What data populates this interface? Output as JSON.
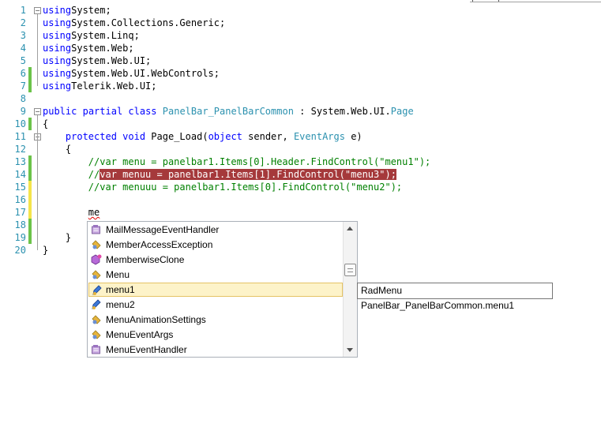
{
  "code_lines": [
    {
      "n": "1",
      "gutter": "none",
      "fold": "minus",
      "tokens": [
        [
          "kw",
          "using"
        ],
        [
          "",
          "System;"
        ]
      ]
    },
    {
      "n": "2",
      "gutter": "none",
      "fold": "",
      "tokens": [
        [
          "kw",
          "using"
        ],
        [
          "",
          "System.Collections.Generic;"
        ]
      ]
    },
    {
      "n": "3",
      "gutter": "none",
      "fold": "",
      "tokens": [
        [
          "kw",
          "using"
        ],
        [
          "",
          "System.Linq;"
        ]
      ]
    },
    {
      "n": "4",
      "gutter": "none",
      "fold": "",
      "tokens": [
        [
          "kw",
          "using"
        ],
        [
          "",
          "System.Web;"
        ]
      ]
    },
    {
      "n": "5",
      "gutter": "none",
      "fold": "",
      "tokens": [
        [
          "kw",
          "using"
        ],
        [
          "",
          "System.Web.UI;"
        ]
      ]
    },
    {
      "n": "6",
      "gutter": "saved",
      "fold": "",
      "tokens": [
        [
          "kw",
          "using"
        ],
        [
          "",
          "System.Web.UI.WebControls;"
        ]
      ]
    },
    {
      "n": "7",
      "gutter": "saved",
      "fold": "",
      "tokens": [
        [
          "kw",
          "using"
        ],
        [
          "",
          "Telerik.Web.UI;"
        ]
      ]
    },
    {
      "n": "8",
      "gutter": "none",
      "fold": "",
      "tokens": []
    },
    {
      "n": "9",
      "gutter": "none",
      "fold": "minus",
      "tokens": [
        [
          "kw",
          "public"
        ],
        [
          "",
          " "
        ],
        [
          "kw",
          "partial"
        ],
        [
          "",
          " "
        ],
        [
          "kw",
          "class"
        ],
        [
          "",
          " "
        ],
        [
          "ty",
          "PanelBar_PanelBarCommon"
        ],
        [
          "",
          " : System.Web.UI."
        ],
        [
          "ty",
          "Page"
        ]
      ]
    },
    {
      "n": "10",
      "gutter": "saved",
      "fold": "",
      "tokens": [
        [
          "",
          "{"
        ]
      ]
    },
    {
      "n": "11",
      "gutter": "none",
      "fold": "minus",
      "tokens": [
        [
          "",
          "    "
        ],
        [
          "kw",
          "protected"
        ],
        [
          "",
          " "
        ],
        [
          "kw",
          "void"
        ],
        [
          "",
          " Page_Load("
        ],
        [
          "kw",
          "object"
        ],
        [
          "",
          " sender, "
        ],
        [
          "ty",
          "EventArgs"
        ],
        [
          "",
          " e)"
        ]
      ]
    },
    {
      "n": "12",
      "gutter": "none",
      "fold": "",
      "tokens": [
        [
          "",
          "    {"
        ]
      ]
    },
    {
      "n": "13",
      "gutter": "saved",
      "fold": "",
      "tokens": [
        [
          "",
          "        "
        ],
        [
          "cm",
          "//var menu = panelbar1.Items[0].Header.FindControl(\"menu1\");"
        ]
      ]
    },
    {
      "n": "14",
      "gutter": "saved",
      "fold": "",
      "tokens": [
        [
          "",
          "        "
        ],
        [
          "cm",
          "//"
        ],
        [
          "hl",
          "var menuu = panelbar1.Items[1].FindControl(\"menu3\");"
        ]
      ]
    },
    {
      "n": "15",
      "gutter": "unsaved",
      "fold": "",
      "tokens": [
        [
          "",
          "        "
        ],
        [
          "cm",
          "//var menuuu = panelbar1.Items[0].FindControl(\"menu2\");"
        ]
      ]
    },
    {
      "n": "16",
      "gutter": "unsaved",
      "fold": "",
      "tokens": []
    },
    {
      "n": "17",
      "gutter": "unsaved",
      "fold": "",
      "tokens": [
        [
          "",
          "        "
        ],
        [
          "squig",
          "me"
        ]
      ]
    },
    {
      "n": "18",
      "gutter": "saved",
      "fold": "",
      "tokens": []
    },
    {
      "n": "19",
      "gutter": "saved",
      "fold": "",
      "tokens": [
        [
          "",
          "    }"
        ]
      ]
    },
    {
      "n": "20",
      "gutter": "none",
      "fold": "",
      "tokens": [
        [
          "",
          "}"
        ]
      ]
    }
  ],
  "completion_list": {
    "items": [
      {
        "label": "MailMessageEventHandler",
        "icon": "delegate-icon"
      },
      {
        "label": "MemberAccessException",
        "icon": "class-icon"
      },
      {
        "label": "MemberwiseClone",
        "icon": "method-icon"
      },
      {
        "label": "Menu",
        "icon": "class-icon"
      },
      {
        "label": "menu1",
        "icon": "field-icon",
        "selected": true
      },
      {
        "label": "menu2",
        "icon": "field-icon"
      },
      {
        "label": "MenuAnimationSettings",
        "icon": "class-icon"
      },
      {
        "label": "MenuEventArgs",
        "icon": "class-icon"
      },
      {
        "label": "MenuEventHandler",
        "icon": "delegate-icon"
      }
    ]
  },
  "tooltip": {
    "text": "RadMenu PanelBar_PanelBarCommon.menu1"
  },
  "colors": {
    "keyword": "#0000ff",
    "type": "#2b91af",
    "comment": "#008000",
    "highlight": "#a5393b",
    "saved": "#6cc34a",
    "unsaved": "#f5e44b"
  }
}
